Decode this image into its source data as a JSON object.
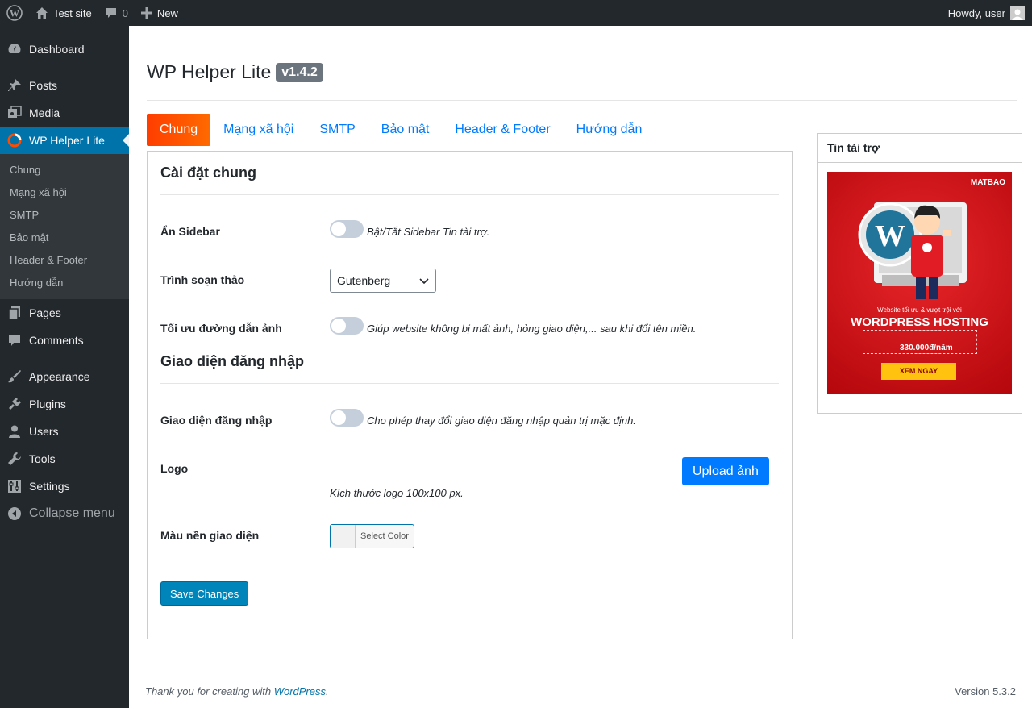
{
  "adminbar": {
    "site_name": "Test site",
    "comments_count": "0",
    "new_label": "New",
    "howdy": "Howdy, user"
  },
  "sidebar": {
    "items": [
      {
        "label": "Dashboard",
        "icon": "dashboard-icon"
      },
      {
        "label": "Posts",
        "icon": "pin-icon"
      },
      {
        "label": "Media",
        "icon": "media-icon"
      },
      {
        "label": "WP Helper Lite",
        "icon": "plugin-logo-icon"
      },
      {
        "label": "Pages",
        "icon": "pages-icon"
      },
      {
        "label": "Comments",
        "icon": "comment-icon"
      },
      {
        "label": "Appearance",
        "icon": "brush-icon"
      },
      {
        "label": "Plugins",
        "icon": "plug-icon"
      },
      {
        "label": "Users",
        "icon": "user-icon"
      },
      {
        "label": "Tools",
        "icon": "wrench-icon"
      },
      {
        "label": "Settings",
        "icon": "settings-icon"
      }
    ],
    "submenu": [
      "Chung",
      "Mạng xã hội",
      "SMTP",
      "Bảo mật",
      "Header & Footer",
      "Hướng dẫn"
    ],
    "collapse": "Collapse menu"
  },
  "page": {
    "title": "WP Helper Lite",
    "version": "v1.4.2"
  },
  "tabs": [
    "Chung",
    "Mạng xã hội",
    "SMTP",
    "Bảo mật",
    "Header & Footer",
    "Hướng dẫn"
  ],
  "section1": {
    "title": "Cài đặt chung",
    "rows": {
      "sidebar": {
        "label": "Ẩn Sidebar",
        "desc": "Bật/Tắt Sidebar Tin tài trợ."
      },
      "editor": {
        "label": "Trình soạn thảo",
        "value": "Gutenberg"
      },
      "images": {
        "label": "Tối ưu đường dẫn ảnh",
        "desc": "Giúp website không bị mất ảnh, hỏng giao diện,... sau khi đổi tên miền."
      }
    }
  },
  "section2": {
    "title": "Giao diện đăng nhập",
    "rows": {
      "login": {
        "label": "Giao diện đăng nhập",
        "desc": "Cho phép thay đổi giao diện đăng nhập quản trị mặc định."
      },
      "logo": {
        "label": "Logo",
        "upload": "Upload ảnh",
        "hint": "Kích thước logo 100x100 px."
      },
      "bgcolor": {
        "label": "Màu nền giao diện",
        "button": "Select Color"
      }
    }
  },
  "save_label": "Save Changes",
  "sponsor": {
    "title": "Tin tài trợ",
    "ad_brand": "MATBAO",
    "ad_line": "Website tối ưu & vượt trội với",
    "ad_headline": "WORDPRESS HOSTING",
    "ad_price": "330.000đ/năm",
    "ad_cta": "XEM NGAY"
  },
  "footer": {
    "text": "Thank you for creating with ",
    "link": "WordPress",
    "period": ".",
    "version": "Version 5.3.2"
  },
  "colors": {
    "adminbar": "#23282d",
    "accent": "#0073aa",
    "tab_active": "#ff4b00",
    "link": "#007bff"
  }
}
